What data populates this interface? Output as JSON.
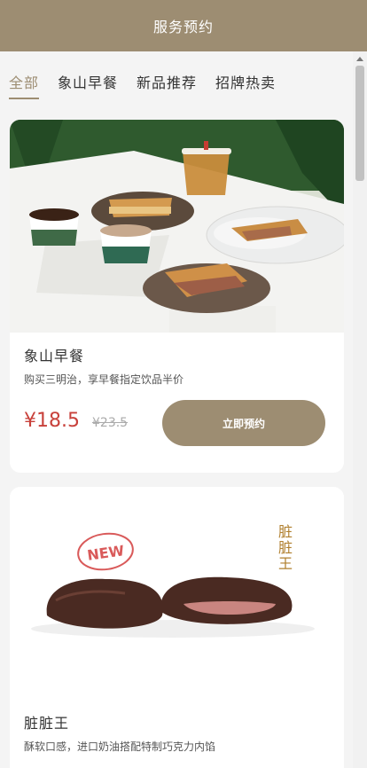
{
  "header": {
    "title": "服务预约"
  },
  "tabs": [
    {
      "label": "全部",
      "active": true
    },
    {
      "label": "新品推荐",
      "active": false
    },
    {
      "label": "象山早餐",
      "active": false
    },
    {
      "label": "招牌热卖",
      "active": false
    }
  ],
  "products": [
    {
      "name": "象山早餐",
      "description": "购买三明治，享早餐指定饮品半价",
      "price": "¥18.5",
      "original_price": "¥23.5",
      "button_label": "立即预约"
    },
    {
      "name": "脏脏王",
      "description": "酥软口感，进口奶油搭配特制巧克力内馅",
      "image_badge": "NEW",
      "image_text": "脏脏王"
    }
  ],
  "colors": {
    "accent": "#9d8d72",
    "price": "#c8413b"
  }
}
